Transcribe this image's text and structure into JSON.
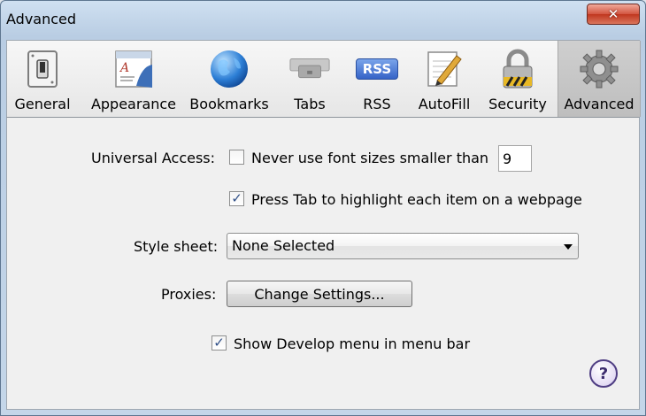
{
  "window": {
    "title": "Advanced",
    "close_label": "✕"
  },
  "toolbar": {
    "items": [
      {
        "label": "General",
        "icon": "switch-icon"
      },
      {
        "label": "Appearance",
        "icon": "appearance-icon"
      },
      {
        "label": "Bookmarks",
        "icon": "globe-icon"
      },
      {
        "label": "Tabs",
        "icon": "tabs-icon"
      },
      {
        "label": "RSS",
        "icon": "rss-icon",
        "icon_text": "RSS"
      },
      {
        "label": "AutoFill",
        "icon": "autofill-pencil-icon"
      },
      {
        "label": "Security",
        "icon": "padlock-icon"
      },
      {
        "label": "Advanced",
        "icon": "gear-icon",
        "selected": true
      }
    ]
  },
  "advanced": {
    "universal_access_label": "Universal Access:",
    "min_font": {
      "label": "Never use font sizes smaller than",
      "checked": false,
      "value": "9"
    },
    "tab_highlight": {
      "label": "Press Tab to highlight each item on a webpage",
      "checked": true
    },
    "style_sheet": {
      "label": "Style sheet:",
      "selected": "None Selected"
    },
    "proxies": {
      "label": "Proxies:",
      "button_label": "Change Settings..."
    },
    "develop_menu": {
      "label": "Show Develop menu in menu bar",
      "checked": true
    },
    "help_label": "?"
  }
}
